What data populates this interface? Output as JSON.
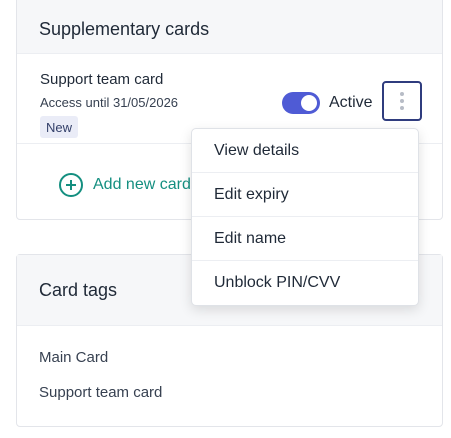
{
  "supplementary": {
    "title": "Supplementary cards",
    "card": {
      "name": "Support team card",
      "access": "Access until 31/05/2026",
      "badge": "New",
      "status_label": "Active",
      "active": true
    },
    "add_label": "Add new card"
  },
  "menu": {
    "items": [
      "View details",
      "Edit expiry",
      "Edit name",
      "Unblock PIN/CVV"
    ]
  },
  "card_tags": {
    "title": "Card tags",
    "items": [
      "Main Card",
      "Support team card"
    ]
  },
  "colors": {
    "accent": "#4f5bd5",
    "add_link": "#148f80",
    "kebab_border": "#2f3c7e"
  },
  "icons": {
    "add": "plus-circle-icon",
    "more": "kebab-icon"
  }
}
